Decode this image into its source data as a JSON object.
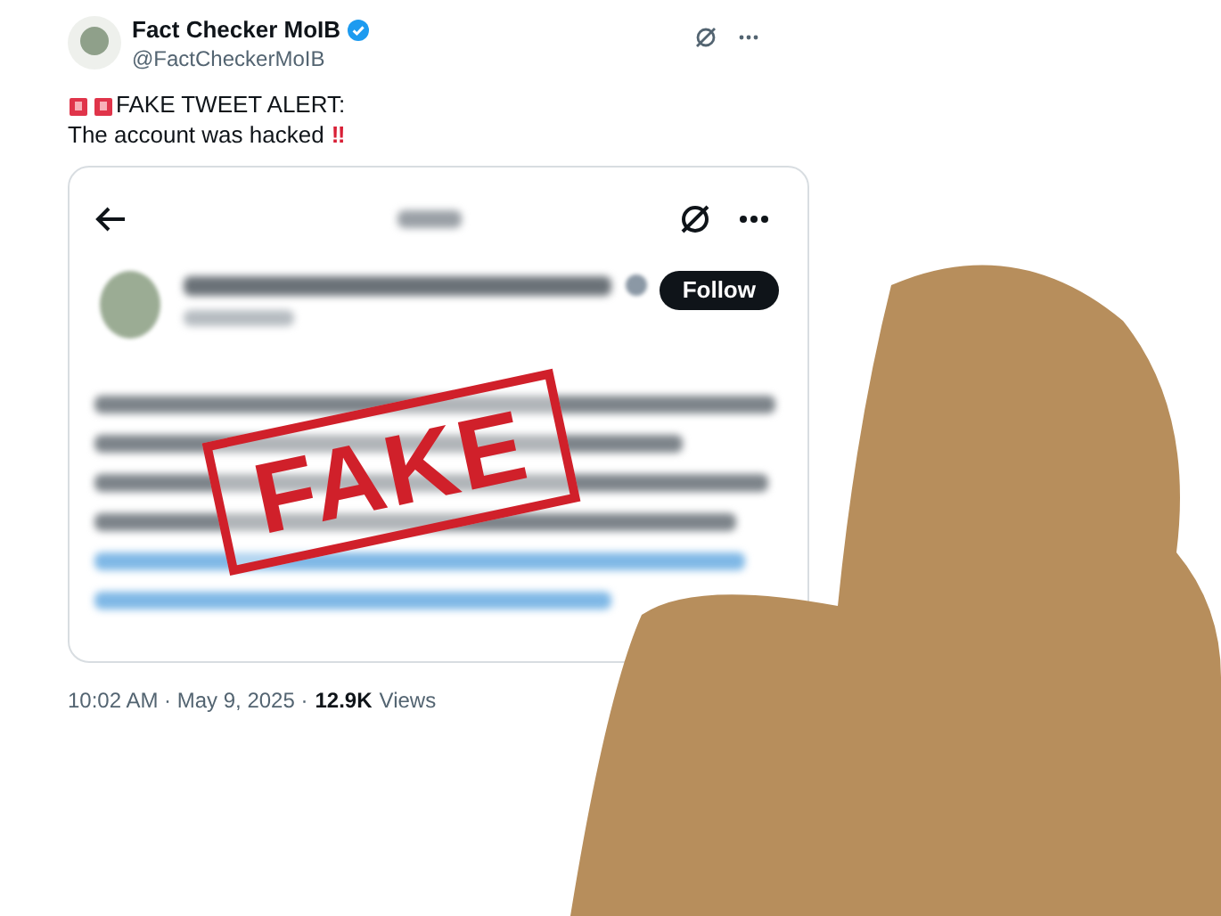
{
  "post": {
    "author": "Fact Checker MoIB",
    "verified": true,
    "handle": "@FactCheckerMoIB",
    "alert": "FAKE TWEET ALERT:",
    "message": "The account was hacked",
    "message_mark": "‼"
  },
  "embedded_post": {
    "follow_button": "Follow",
    "stamp": "FAKE"
  },
  "footer": {
    "time": "10:02 AM · May 9, 2025 ·",
    "views_count": "12.9K",
    "views_label": "Views"
  }
}
